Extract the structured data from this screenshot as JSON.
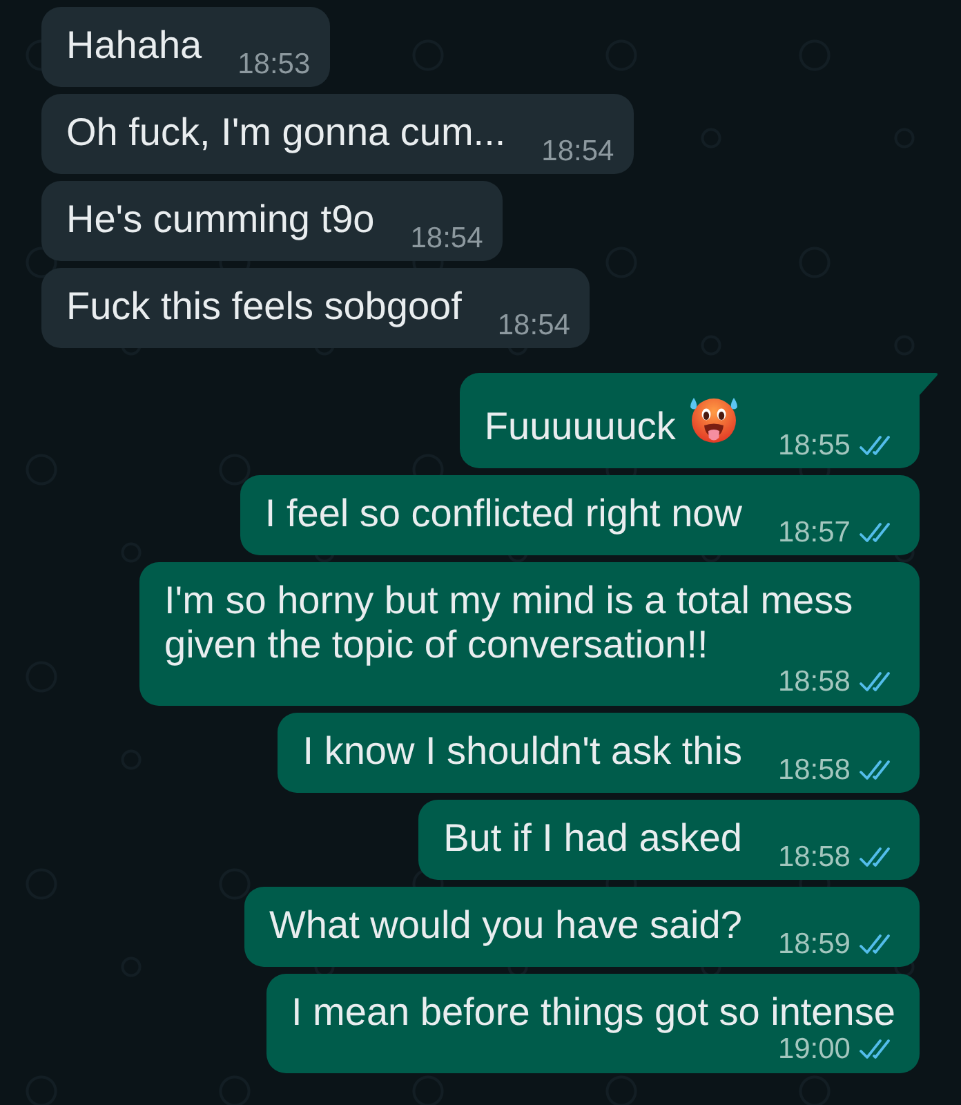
{
  "messages": [
    {
      "kind": "incoming",
      "text": "Hahaha",
      "time": "18:53",
      "tail": false
    },
    {
      "kind": "incoming",
      "text": "Oh fuck, I'm gonna cum...",
      "time": "18:54",
      "tail": false
    },
    {
      "kind": "incoming",
      "text": "He's cumming t9o",
      "time": "18:54",
      "tail": false
    },
    {
      "kind": "incoming",
      "text": "Fuck this feels sobgoof",
      "time": "18:54",
      "tail": false
    },
    {
      "kind": "outgoing",
      "text": "Fuuuuuuck",
      "emoji": true,
      "time": "18:55",
      "read": true,
      "tail": true
    },
    {
      "kind": "outgoing",
      "text": "I feel so conflicted right now",
      "time": "18:57",
      "read": true,
      "tail": false
    },
    {
      "kind": "outgoing",
      "text": "I'm so horny but my mind is a total mess given the topic of conversation!!",
      "time": "18:58",
      "read": true,
      "tail": false
    },
    {
      "kind": "outgoing",
      "text": "I know I shouldn't ask this",
      "time": "18:58",
      "read": true,
      "tail": false
    },
    {
      "kind": "outgoing",
      "text": "But if I had asked",
      "time": "18:58",
      "read": true,
      "tail": false
    },
    {
      "kind": "outgoing",
      "text": "What would you have said?",
      "time": "18:59",
      "read": true,
      "tail": false
    },
    {
      "kind": "outgoing",
      "text": "I mean before things got so intense",
      "time": "19:00",
      "read": true,
      "tail": false
    }
  ]
}
